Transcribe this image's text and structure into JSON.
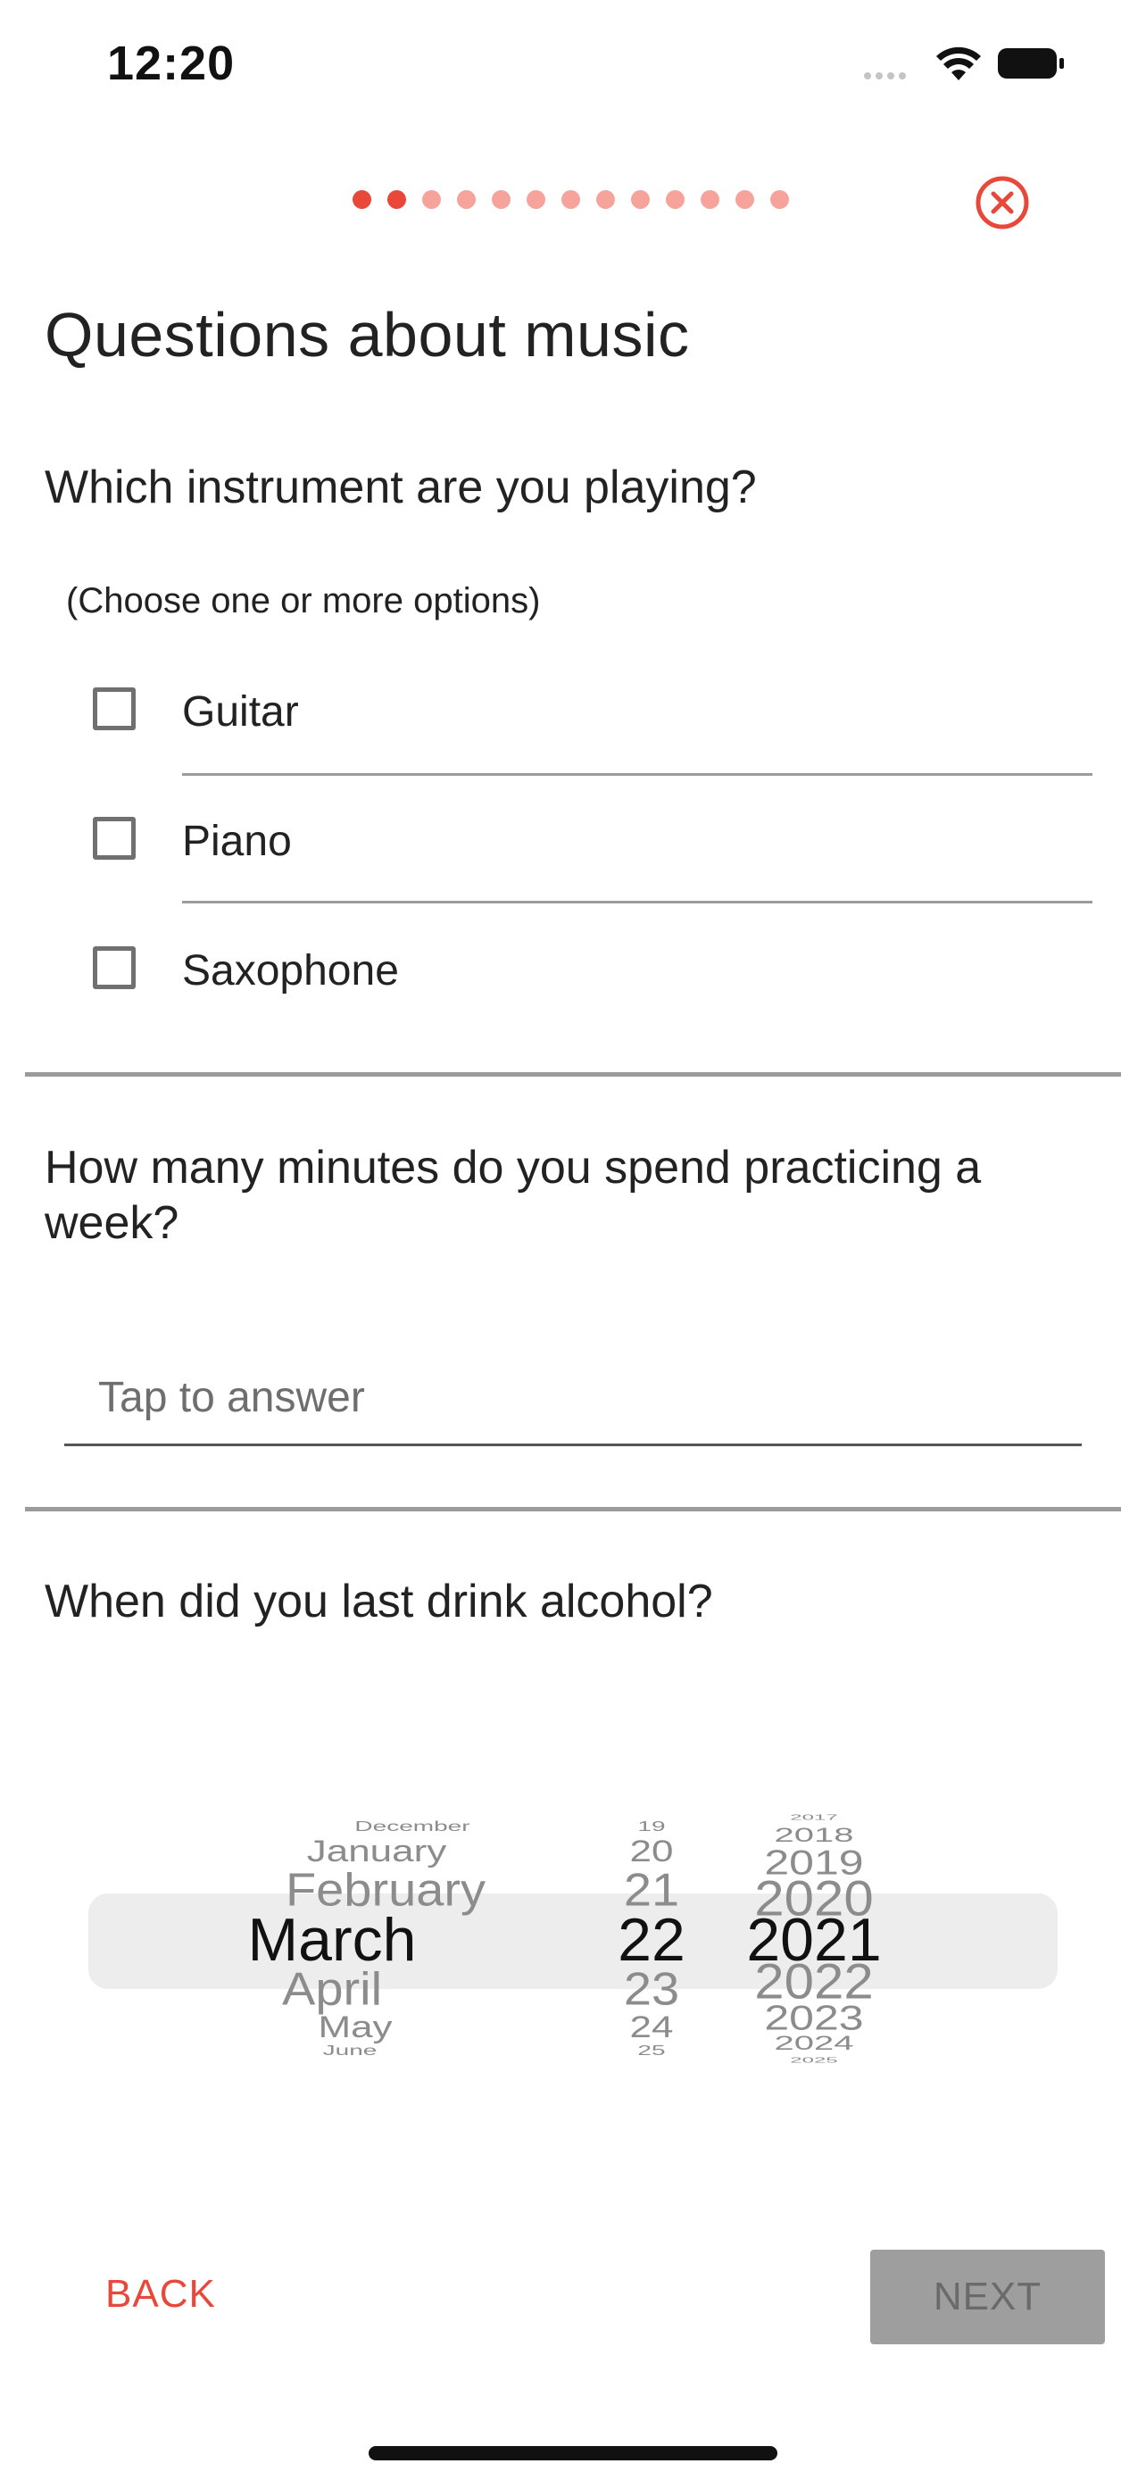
{
  "status_bar": {
    "time": "12:20",
    "icons": [
      "signal-icon",
      "wifi-icon",
      "battery-icon"
    ]
  },
  "progress": {
    "total_steps": 13,
    "current_step": 2,
    "active_color": "#e8473a",
    "inactive_color": "#f5a39b"
  },
  "header": {
    "close_icon": "close-circle-icon"
  },
  "page": {
    "title": "Questions about music"
  },
  "question1": {
    "text": "Which instrument are you playing?",
    "hint": "(Choose one or more options)",
    "options": [
      {
        "label": "Guitar",
        "checked": false
      },
      {
        "label": "Piano",
        "checked": false
      },
      {
        "label": "Saxophone",
        "checked": false
      }
    ]
  },
  "question2": {
    "text": "How many minutes do you spend practicing a week?",
    "placeholder": "Tap to answer",
    "value": ""
  },
  "question3": {
    "text": "When did you last drink alcohol?",
    "picker": {
      "months": [
        "December",
        "January",
        "February",
        "March",
        "April",
        "May",
        "June"
      ],
      "days": [
        "19",
        "20",
        "21",
        "22",
        "23",
        "24",
        "25"
      ],
      "years": [
        "2017",
        "2018",
        "2019",
        "2020",
        "2021",
        "2022",
        "2023",
        "2024",
        "2025"
      ],
      "selected": {
        "month": "March",
        "day": "22",
        "year": "2021"
      }
    }
  },
  "footer": {
    "back_label": "BACK",
    "next_label": "NEXT"
  },
  "colors": {
    "accent": "#e8473a",
    "divider": "#9b9b9b",
    "disabled_button": "#9e9e9e"
  }
}
